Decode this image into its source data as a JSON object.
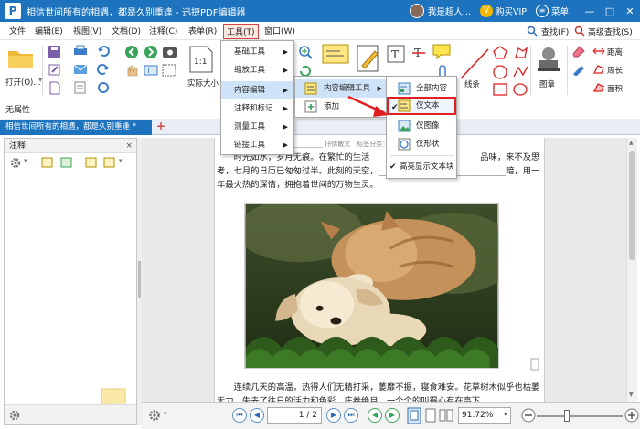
{
  "window": {
    "title": "相信世间所有的相遇，都是久别重逢 - 迅捷PDF编辑器",
    "user_name": "我是超人...",
    "vip_label": "购买VIP",
    "menu_label": "菜单",
    "minimize": "—",
    "maximize": "□",
    "close": "✕"
  },
  "menubar": {
    "items": [
      "文件",
      "编辑(E)",
      "视图(V)",
      "文档(D)",
      "注释(C)",
      "表单(R)",
      "工具(T)",
      "窗口(W)"
    ],
    "active": "工具(T)",
    "find": "查找(F)",
    "advanced_find": "高级查找(S)"
  },
  "ribbon": {
    "open_label": "打开(O)...",
    "actual_size_label": "实际大小",
    "actual_size_icon_text": "1:1",
    "line_label": "线条",
    "stamp_label": "图章",
    "distance_label": "距离",
    "perimeter_label": "周长",
    "area_label": "面积",
    "props_label": "无属性"
  },
  "tabs": {
    "doc_tab": "相信世间所有的相遇，都是久别重逢 *",
    "add": "+"
  },
  "sidepanel": {
    "title": "注释",
    "close": "×"
  },
  "document": {
    "meta_line": "__________ 抒情散文　标签分类：抒情散文",
    "para1": "　　时光如水，岁月无痕。在繁忙的生活__________________________品味，来不及思考，七月的日历已匆匆过半。此刻的天空，______________________________暗，用一年最火热的深情，拥抱着世间的万物生灵。",
    "para2": "　　连续几天的高温，热得人们无精打采，萎靡不振，寝食难安。花草树木似乎也枯萎无力，失去了往日的活力和色彩。庄卷绝目，一个个的叫得心有在高下"
  },
  "statusbar": {
    "page_value": "1 / 2",
    "zoom_value": "91.72%"
  },
  "menu_tools": {
    "items": [
      "基础工具",
      "缩放工具",
      "内容编辑",
      "注释和标记",
      "测量工具",
      "链接工具"
    ],
    "highlighted": "内容编辑"
  },
  "menu_content_edit": {
    "items": [
      "内容编辑工具",
      "添加"
    ],
    "highlighted": "内容编辑工具"
  },
  "menu_edit_tools": {
    "items": [
      "全部内容",
      "仅文本",
      "仅图像",
      "仅形状",
      "高亮显示文本块"
    ],
    "selected": "仅文本"
  },
  "colors": {
    "title_blue": "#1e73be",
    "highlight_red": "#e02020",
    "menu_hover": "#cfe3f8"
  }
}
